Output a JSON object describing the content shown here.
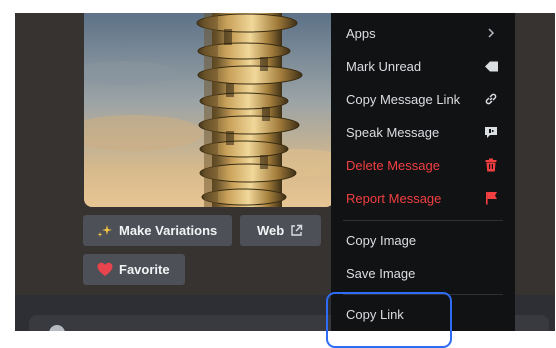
{
  "message": {
    "image_description_name": "golden-tower-image",
    "buttons": {
      "make_variations": "Make Variations",
      "web": "Web",
      "favorite": "Favorite"
    }
  },
  "context_menu": {
    "items": [
      {
        "label": "Apps",
        "icon": "chevron-right-icon",
        "danger": false
      },
      {
        "label": "Mark Unread",
        "icon": "mark-unread-icon",
        "danger": false
      },
      {
        "label": "Copy Message Link",
        "icon": "link-icon",
        "danger": false
      },
      {
        "label": "Speak Message",
        "icon": "speak-icon",
        "danger": false
      },
      {
        "label": "Delete Message",
        "icon": "trash-icon",
        "danger": true
      },
      {
        "label": "Report Message",
        "icon": "flag-icon",
        "danger": true
      },
      {
        "label": "Copy Image",
        "icon": "",
        "danger": false
      },
      {
        "label": "Save Image",
        "icon": "",
        "danger": false
      },
      {
        "label": "Copy Link",
        "icon": "",
        "danger": false
      }
    ]
  },
  "colors": {
    "menu_bg": "#111214",
    "danger": "#f23f42",
    "highlight": "#2e6cf6",
    "button_bg": "#4e5058"
  }
}
